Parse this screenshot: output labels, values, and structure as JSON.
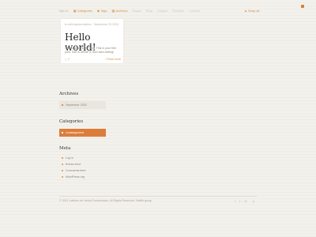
{
  "nav": {
    "items": [
      {
        "label": "Nav br"
      },
      {
        "label": "Categories",
        "icon": "folder-icon"
      },
      {
        "label": "Tags",
        "icon": "tag-icon"
      },
      {
        "label": "Archives",
        "icon": "calendar-icon"
      },
      {
        "label": "Pages"
      },
      {
        "label": "Blog"
      },
      {
        "label": "Sample"
      },
      {
        "label": "Portfolio"
      },
      {
        "label": "Contact"
      }
    ],
    "shop_label": "Shop all"
  },
  "post": {
    "meta": "nothingelsematters · September 25 2020",
    "title": "Hello world!",
    "excerpt": "Welcome to WordPress. This is your first post. Edit or delete it, then start writing!",
    "comments": "0",
    "read_more": "Read more"
  },
  "archives": {
    "title": "Archives",
    "items": [
      "September 2020"
    ]
  },
  "categories": {
    "title": "Categories",
    "items": [
      "Uncategorized"
    ]
  },
  "meta": {
    "title": "Meta",
    "items": [
      "Log in",
      "Entries feed",
      "Comments feed",
      "WordPress.org"
    ]
  },
  "footer": {
    "copyright": "© 2021 Instituto de Venta Encuentrado. All Rights Reserved. Waffle group",
    "social_icons": [
      "facebook-icon",
      "twitter-icon",
      "instagram-icon",
      "pinterest-icon"
    ]
  },
  "colors": {
    "accent": "#dc7d3b",
    "background": "#f3f1ec"
  }
}
